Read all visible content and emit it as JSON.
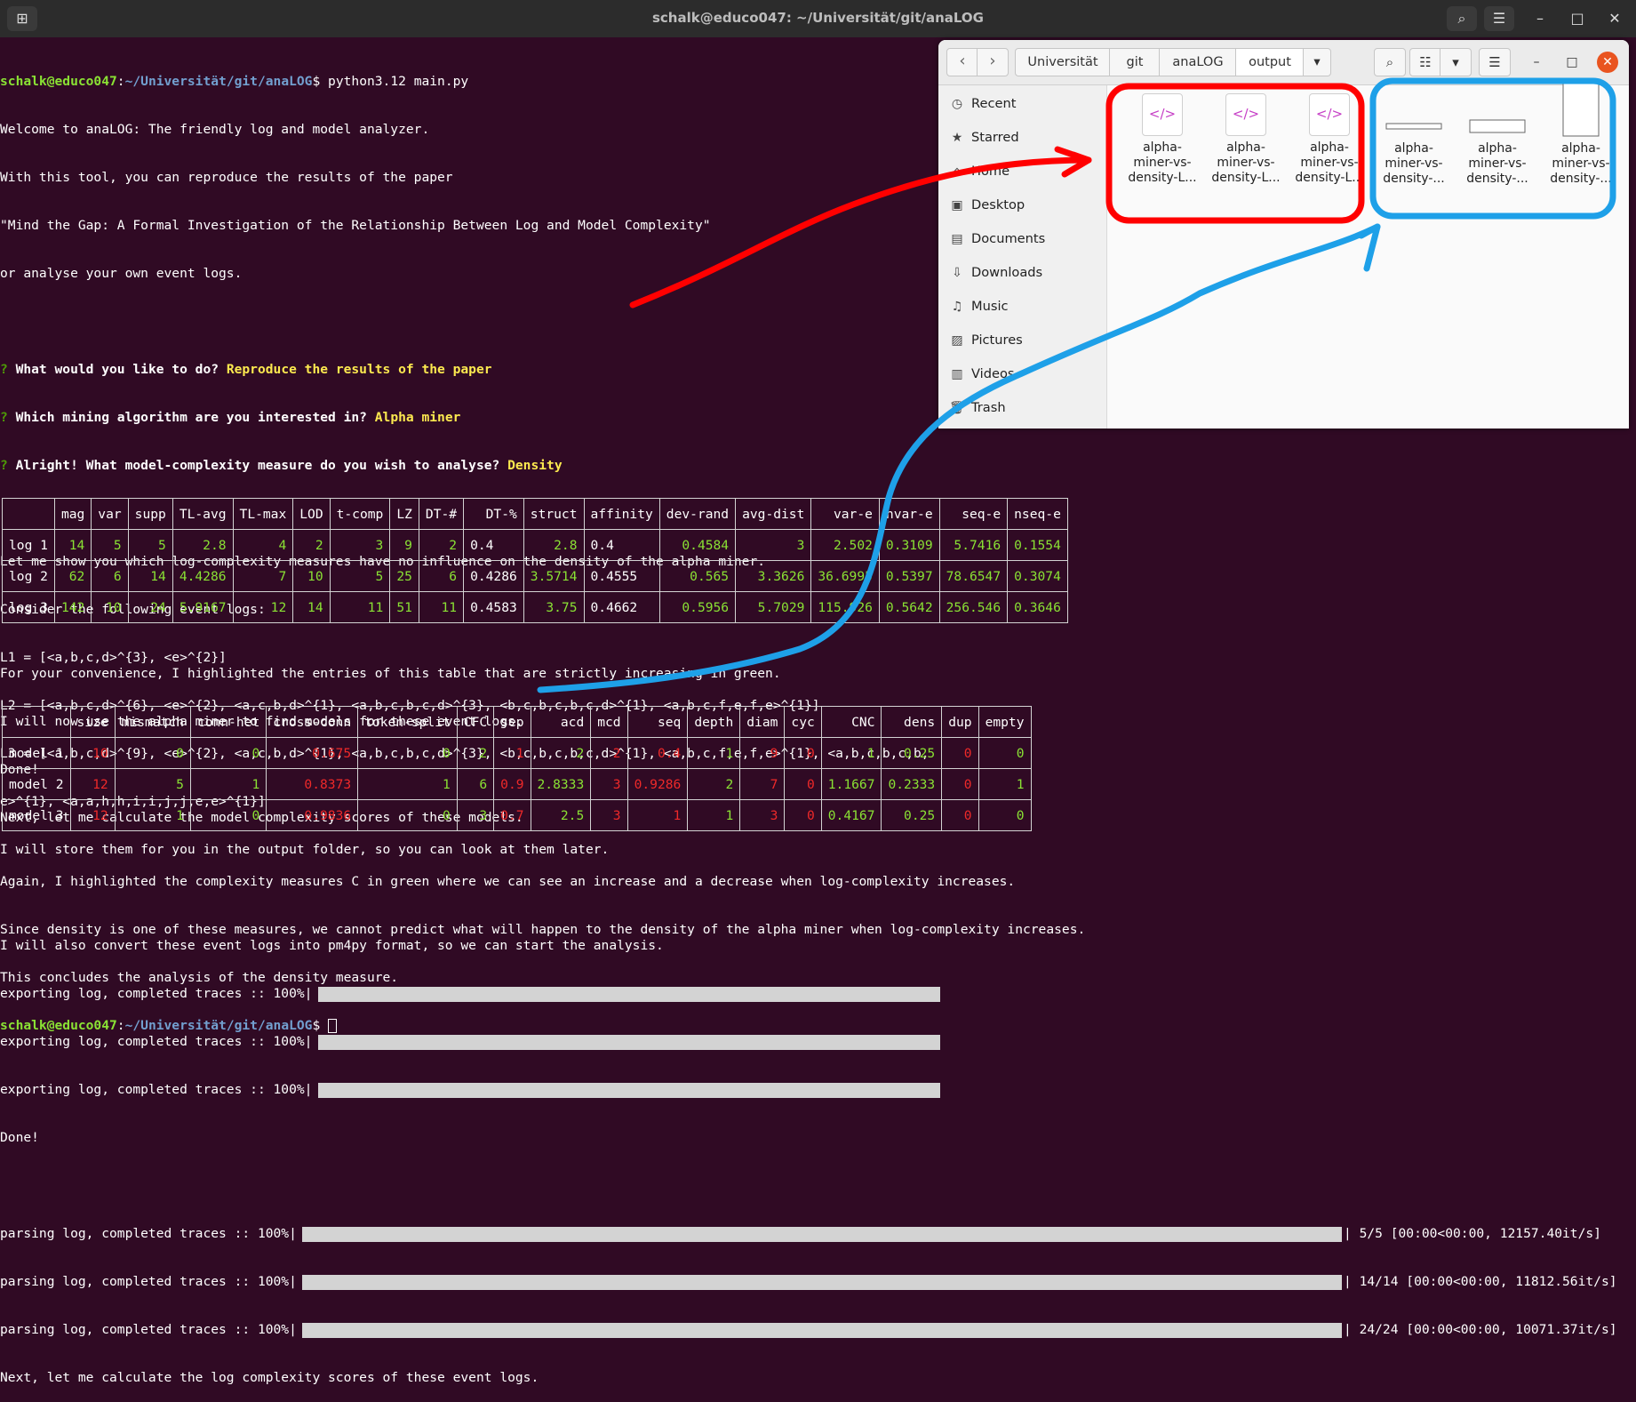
{
  "window": {
    "title": "schalk@educo047: ~/Universität/git/anaLOG"
  },
  "prompt": {
    "user": "schalk@educo047",
    "path": "~/Universität/git/anaLOG",
    "symbol": "$ ",
    "command": "python3.12 main.py"
  },
  "intro": [
    "Welcome to anaLOG: The friendly log and model analyzer.",
    "With this tool, you can reproduce the results of the paper",
    "\"Mind the Gap: A Formal Investigation of the Relationship Between Log and Model Complexity\"",
    "or analyse your own event logs."
  ],
  "questions": [
    {
      "mark": "? ",
      "q": "What would you like to do? ",
      "a": "Reproduce the results of the paper"
    },
    {
      "mark": "? ",
      "q": "Which mining algorithm are you interested in? ",
      "a": "Alpha miner"
    },
    {
      "mark": "? ",
      "q": "Alright! What model-complexity measure do you wish to analyse? ",
      "a": "Density"
    }
  ],
  "logs_text": [
    "Let me show you which log-complexity measures have no influence on the density of the alpha miner.",
    "Consider the following event logs:",
    "L1 = [<a,b,c,d>^{3}, <e>^{2}]",
    "L2 = [<a,b,c,d>^{6}, <e>^{2}, <a,c,b,d>^{1}, <a,b,c,b,c,d>^{3}, <b,c,b,c,b,c,d>^{1}, <a,b,c,f,e,f,e>^{1}]",
    "L3 = [<a,b,c,d>^{9}, <e>^{2}, <a,c,b,d>^{1}, <a,b,c,b,c,d>^{3}, <b,c,b,c,b,c,d>^{1}, <a,b,c,f,e,f,e>^{1}, <a,b,c,b,c,b,",
    "e>^{1}, <a,a,h,h,i,i,j,j,e,e>^{1}]",
    "I will store them for you in the output folder, so you can look at them later.",
    "",
    "I will also convert these event logs into pm4py format, so we can start the analysis."
  ],
  "export_lines": [
    "exporting log, completed traces :: 100%|",
    "exporting log, completed traces :: 100%|",
    "exporting log, completed traces :: 100%|"
  ],
  "done": "Done!",
  "parse_lines": [
    "parsing log, completed traces :: 100%|",
    "parsing log, completed traces :: 100%|",
    "parsing log, completed traces :: 100%|"
  ],
  "parse_stats": [
    "| 5/5 [00:00<00:00, 12157.40it/s]",
    "| 14/14 [00:00<00:00, 11812.56it/s]",
    "| 24/24 [00:00<00:00, 10071.37it/s]"
  ],
  "log_calc": "Next, let me calculate the log complexity scores of these event logs.",
  "log_table": {
    "headers": [
      "",
      "mag",
      "var",
      "supp",
      "TL-avg",
      "TL-max",
      "LOD",
      "t-comp",
      "LZ",
      "DT-#",
      "DT-%",
      "struct",
      "affinity",
      "dev-rand",
      "avg-dist",
      "var-e",
      "nvar-e",
      "seq-e",
      "nseq-e"
    ],
    "rows": [
      [
        "log 1",
        "14",
        "5",
        "5",
        "2.8",
        "4",
        "2",
        "3",
        "9",
        "2",
        "0.4",
        "2.8",
        "0.4",
        "0.4584",
        "3",
        "2.502",
        "0.3109",
        "5.7416",
        "0.1554"
      ],
      [
        "log 2",
        "62",
        "6",
        "14",
        "4.4286",
        "7",
        "10",
        "5",
        "25",
        "6",
        "0.4286",
        "3.5714",
        "0.4555",
        "0.565",
        "3.3626",
        "36.6995",
        "0.5397",
        "78.6547",
        "0.3074"
      ],
      [
        "log 3",
        "142",
        "10",
        "24",
        "5.9167",
        "12",
        "14",
        "11",
        "51",
        "11",
        "0.4583",
        "3.75",
        "0.4662",
        "0.5956",
        "5.7029",
        "115.926",
        "0.5642",
        "256.546",
        "0.3646"
      ]
    ],
    "colors": [
      "w",
      "g",
      "g",
      "g",
      "g",
      "g",
      "g",
      "g",
      "g",
      "g",
      "w",
      "g",
      "w",
      "g",
      "g",
      "g",
      "g",
      "g",
      "g"
    ]
  },
  "mid_text": [
    "For your convenience, I highlighted the entries of this table that are strictly increasing in green.",
    "I will now use the alpha miner to find models for these event logs.",
    "Done!",
    "Next, let me calculate the model complexity scores of these models."
  ],
  "model_table": {
    "headers": [
      "",
      "size",
      "mismatch",
      "conn-het",
      "cross-conn",
      "token-split",
      "CFC",
      "sep",
      "acd",
      "mcd",
      "seq",
      "depth",
      "diam",
      "cyc",
      "CNC",
      "dens",
      "dup",
      "empty"
    ],
    "rows": [
      [
        "model 1",
        "10",
        "0",
        "0",
        "0.675",
        "0",
        "2",
        "1",
        "2",
        "2",
        "0.4",
        "1",
        "9",
        "0",
        "1",
        "0.25",
        "0",
        "0"
      ],
      [
        "model 2",
        "12",
        "5",
        "1",
        "0.8373",
        "1",
        "6",
        "0.9",
        "2.8333",
        "3",
        "0.9286",
        "2",
        "7",
        "0",
        "1.1667",
        "0.2333",
        "0",
        "1"
      ],
      [
        "model 3",
        "12",
        "1",
        "0",
        "0.9836",
        "0",
        "3",
        "0.7",
        "2.5",
        "3",
        "1",
        "1",
        "3",
        "0",
        "0.4167",
        "0.25",
        "0",
        "0"
      ]
    ],
    "colors": [
      "w",
      "r",
      "g",
      "g",
      "r",
      "g",
      "g",
      "r",
      "g",
      "r",
      "r",
      "g",
      "r",
      "r",
      "g",
      "g",
      "r",
      "g"
    ]
  },
  "end_text": [
    "Again, I highlighted the complexity measures C in green where we can see an increase and a decrease when log-complexity increases.",
    "Since density is one of these measures, we cannot predict what will happen to the density of the alpha miner when log-complexity increases.",
    "This concludes the analysis of the density measure."
  ],
  "file_manager": {
    "breadcrumbs": [
      "Universität",
      "git",
      "anaLOG",
      "output"
    ],
    "sidebar": [
      {
        "label": "Recent",
        "icon": "clock-icon",
        "glyph": "◷"
      },
      {
        "label": "Starred",
        "icon": "star-icon",
        "glyph": "★"
      },
      {
        "label": "Home",
        "icon": "home-icon",
        "glyph": "⌂"
      },
      {
        "label": "Desktop",
        "icon": "desktop-icon",
        "glyph": "▣"
      },
      {
        "label": "Documents",
        "icon": "documents-icon",
        "glyph": "▤"
      },
      {
        "label": "Downloads",
        "icon": "downloads-icon",
        "glyph": "⇩"
      },
      {
        "label": "Music",
        "icon": "music-icon",
        "glyph": "♫"
      },
      {
        "label": "Pictures",
        "icon": "pictures-icon",
        "glyph": "▨"
      },
      {
        "label": "Videos",
        "icon": "videos-icon",
        "glyph": "▥"
      },
      {
        "label": "Trash",
        "icon": "trash-icon",
        "glyph": "🗑"
      }
    ],
    "files": [
      {
        "name": [
          "alpha-",
          "miner-vs-",
          "density-L..."
        ],
        "kind": "html"
      },
      {
        "name": [
          "alpha-",
          "miner-vs-",
          "density-L..."
        ],
        "kind": "html"
      },
      {
        "name": [
          "alpha-",
          "miner-vs-",
          "density-L..."
        ],
        "kind": "html"
      },
      {
        "name": [
          "alpha-",
          "miner-vs-",
          "density-..."
        ],
        "kind": "image"
      },
      {
        "name": [
          "alpha-",
          "miner-vs-",
          "density-..."
        ],
        "kind": "image"
      },
      {
        "name": [
          "alpha-",
          "miner-vs-",
          "density-..."
        ],
        "kind": "image"
      }
    ],
    "file_icon_glyph": "</>"
  },
  "colors": {
    "terminal_bg": "#300a24",
    "green": "#8ae234",
    "red": "#ef2929",
    "yellow": "#fce94f",
    "prompt_path": "#729fcf",
    "annotation_red": "#ff0000",
    "annotation_blue": "#1ea0e8"
  }
}
